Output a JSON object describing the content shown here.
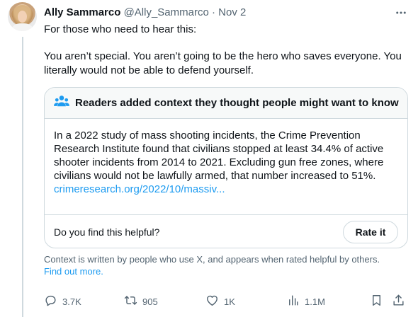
{
  "tweet": {
    "author_name": "Ally Sammarco",
    "handle": "@Ally_Sammarco",
    "separator": "·",
    "date": "Nov 2",
    "text_line1": "For those who need to hear this:",
    "text_line2": "You aren’t special. You aren’t going to be the hero who saves everyone. You literally would not be able to defend yourself."
  },
  "community_note": {
    "icon": "people-icon",
    "title": "Readers added context they thought people might want to know",
    "body": "In a 2022 study of mass shooting incidents, the Crime Prevention Research Institute found that civilians stopped at least 34.4% of active shooter incidents from 2014 to 2021. Excluding gun free zones, where civilians would not be lawfully armed, that number increased to 51%.",
    "link_text": "crimeresearch.org/2022/10/massiv...",
    "helpful_question": "Do you find this helpful?",
    "rate_button": "Rate it"
  },
  "context_footer": {
    "text": "Context is written by people who use X, and appears when rated helpful by others.",
    "learn_more": "Find out more."
  },
  "actions": {
    "replies": "3.7K",
    "retweets": "905",
    "likes": "1K",
    "views": "1.1M"
  },
  "colors": {
    "accent": "#1d9bf0",
    "secondary_text": "#536471",
    "border": "#cfd9de",
    "note_header_bg": "#f7f9f9"
  }
}
